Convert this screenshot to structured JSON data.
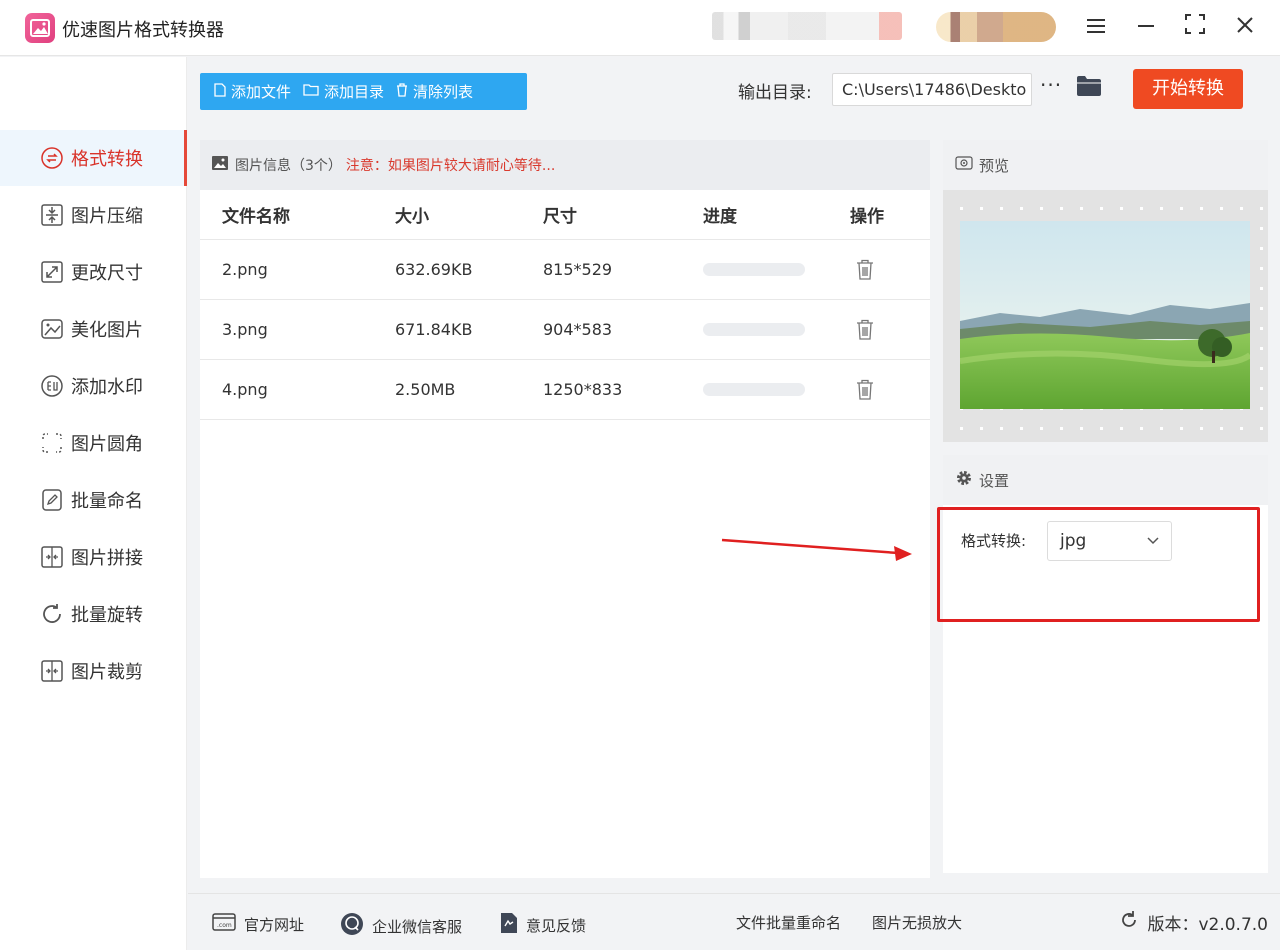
{
  "app": {
    "title": "优速图片格式转换器"
  },
  "sidebar": {
    "items": [
      {
        "label": "格式转换",
        "icon": "convert-icon",
        "active": true
      },
      {
        "label": "图片压缩",
        "icon": "compress-icon"
      },
      {
        "label": "更改尺寸",
        "icon": "resize-icon"
      },
      {
        "label": "美化图片",
        "icon": "beautify-icon"
      },
      {
        "label": "添加水印",
        "icon": "watermark-icon"
      },
      {
        "label": "图片圆角",
        "icon": "round-corner-icon"
      },
      {
        "label": "批量命名",
        "icon": "rename-icon"
      },
      {
        "label": "图片拼接",
        "icon": "stitch-icon"
      },
      {
        "label": "批量旋转",
        "icon": "rotate-icon"
      },
      {
        "label": "图片裁剪",
        "icon": "crop-icon"
      }
    ]
  },
  "toolbar": {
    "add_file": "添加文件",
    "add_dir": "添加目录",
    "clear_list": "清除列表",
    "output_label": "输出目录:",
    "output_path": "C:\\Users\\17486\\Deskto",
    "more": "···",
    "start": "开始转换"
  },
  "file_panel": {
    "header": "图片信息（3个）",
    "warning": "注意：如果图片较大请耐心等待...",
    "columns": [
      "文件名称",
      "大小",
      "尺寸",
      "进度",
      "操作"
    ],
    "rows": [
      {
        "name": "2.png",
        "size": "632.69KB",
        "dims": "815*529",
        "progress": 0
      },
      {
        "name": "3.png",
        "size": "671.84KB",
        "dims": "904*583",
        "progress": 0
      },
      {
        "name": "4.png",
        "size": "2.50MB",
        "dims": "1250*833",
        "progress": 0
      }
    ]
  },
  "preview": {
    "title": "预览"
  },
  "settings": {
    "title": "设置",
    "format_label": "格式转换:",
    "format_value": "jpg"
  },
  "footer": {
    "website": "官方网址",
    "wechat": "企业微信客服",
    "feedback": "意见反馈",
    "batch_rename": "文件批量重命名",
    "lossless_enlarge": "图片无损放大",
    "version_label": "版本：v2.0.7.0"
  },
  "colors": {
    "accent_blue": "#2ea7f1",
    "start_orange": "#ef4a22",
    "active_red": "#d9332a",
    "highlight_red": "#e02020"
  }
}
